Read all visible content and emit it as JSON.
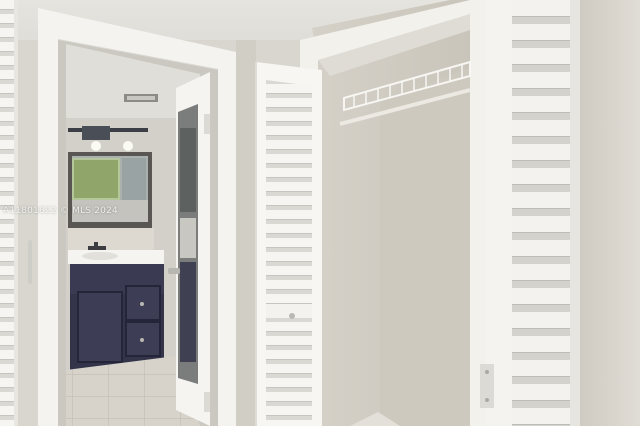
{
  "photo": {
    "watermark": "A11801822 © MLS 2024"
  }
}
